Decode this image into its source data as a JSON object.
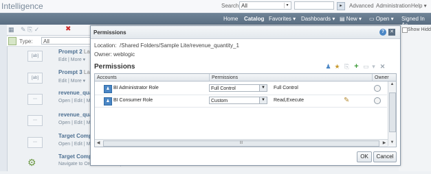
{
  "header": {
    "brand": "Intelligence",
    "search_label": "Search",
    "search_scope": "All",
    "links": {
      "advanced": "Advanced",
      "administration": "Administration",
      "help": "Help ▾"
    }
  },
  "nav": {
    "home": "Home",
    "catalog": "Catalog",
    "favorites": "Favorites ▾",
    "dashboards": "Dashboards ▾",
    "new": "New ▾",
    "open": "Open ▾",
    "signed_in": "Signed In As"
  },
  "catalog": {
    "type_label": "Type:",
    "type_value": "All",
    "show_hidden": "Show Hidd",
    "items": [
      {
        "title": "Prompt 2",
        "meta": "Last",
        "actions": "Edit | More ▾",
        "icon": "abc"
      },
      {
        "title": "Prompt 3",
        "meta": "Last",
        "actions": "Edit | More ▾",
        "icon": "abc"
      },
      {
        "title": "revenue_quant",
        "meta": "",
        "actions": "Open | Edit | More",
        "icon": "chart"
      },
      {
        "title": "revenue_quant",
        "meta": "",
        "actions": "Open | Edit | More",
        "icon": "chart"
      },
      {
        "title": "Target Complet",
        "meta": "",
        "actions": "Open | Edit | More",
        "icon": "chart"
      },
      {
        "title": "Target Complet",
        "meta": "",
        "actions": "Navigate to Orders Detail Report",
        "icon": "gear"
      }
    ]
  },
  "dialog": {
    "title": "Permissions",
    "location_label": "Location:",
    "location_value": "/Shared Folders/Sample Lite/revenue_quantity_1",
    "owner_label": "Owner:",
    "owner_value": "weblogic",
    "section_title": "Permissions",
    "columns": {
      "accounts": "Accounts",
      "permissions": "Permissions",
      "owner": "Owner"
    },
    "rows": [
      {
        "account": "BI Administrator Role",
        "permission": "Full Control",
        "detail": "Full Control"
      },
      {
        "account": "BI Consumer Role",
        "permission": "Custom",
        "detail": "Read,Execute"
      }
    ],
    "hscroll_label": "III",
    "ok_label": "OK",
    "cancel_label": "Cancel"
  },
  "colors": {
    "nav_bar": "#5a6e82",
    "link_blue": "#4c6f91",
    "role_icon": "#4a86c5"
  }
}
